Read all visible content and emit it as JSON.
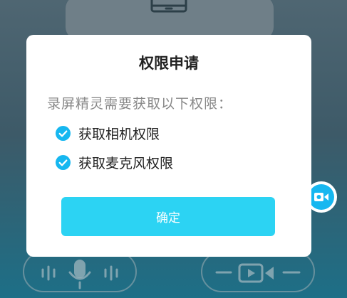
{
  "dialog": {
    "title": "权限申请",
    "description": "录屏精灵需要获取以下权限：",
    "permissions": [
      {
        "label": "获取相机权限",
        "checked": true,
        "icon": "check-circle-icon"
      },
      {
        "label": "获取麦克风权限",
        "checked": true,
        "icon": "check-circle-icon"
      }
    ],
    "confirm_label": "确定"
  },
  "background": {
    "top_icon": "tablet-icon",
    "audio_control_icon": "microphone-icon",
    "video_control_icon": "video-camera-icon",
    "floating_button_icon": "camera-icon"
  },
  "colors": {
    "accent": "#2cd3f3",
    "check": "#16b7f0",
    "title_text": "#222222",
    "secondary_text": "#888888"
  }
}
